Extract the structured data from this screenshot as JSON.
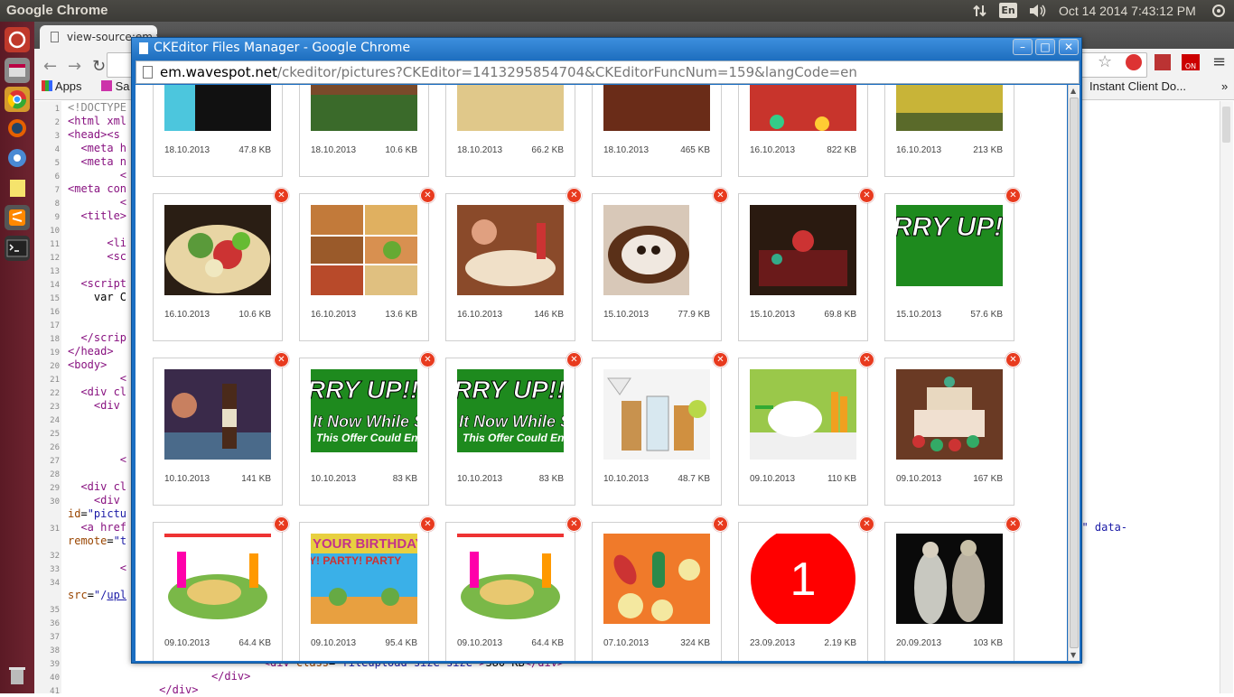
{
  "topbar": {
    "app_title": "Google Chrome",
    "language": "En",
    "clock": "Oct 14 2014  7:43:12 PM"
  },
  "background_chrome": {
    "tab_title": "view-source:em.wavesp",
    "bookmarks": [
      "Apps",
      "Sa"
    ],
    "right_bookmark": "Instant Client Do...",
    "source_lines": [
      {
        "n": "1",
        "html": "<span class='cmt'>&lt;!DOCTYPE</span>"
      },
      {
        "n": "2",
        "html": "<span class='tag'>&lt;html xml</span>"
      },
      {
        "n": "3",
        "html": "<span class='tag'>&lt;head&gt;&lt;s</span>"
      },
      {
        "n": "4",
        "html": "  <span class='tag'>&lt;meta h</span>"
      },
      {
        "n": "5",
        "html": "  <span class='tag'>&lt;meta n</span>"
      },
      {
        "n": "6",
        "html": "        <span class='tag'>&lt;</span>"
      },
      {
        "n": "7",
        "html": "<span class='tag'>&lt;meta con</span>"
      },
      {
        "n": "8",
        "html": "        <span class='tag'>&lt;</span>"
      },
      {
        "n": "9",
        "html": "  <span class='tag'>&lt;title&gt;</span>"
      },
      {
        "n": "10",
        "html": ""
      },
      {
        "n": "11",
        "html": "      <span class='tag'>&lt;li</span>"
      },
      {
        "n": "12",
        "html": "      <span class='tag'>&lt;sc</span>"
      },
      {
        "n": "13",
        "html": ""
      },
      {
        "n": "14",
        "html": "  <span class='tag'>&lt;script</span>"
      },
      {
        "n": "15",
        "html": "    var C"
      },
      {
        "n": "16",
        "html": ""
      },
      {
        "n": "17",
        "html": ""
      },
      {
        "n": "18",
        "html": "  <span class='tag'>&lt;/scrip</span>"
      },
      {
        "n": "19",
        "html": "<span class='tag'>&lt;/head&gt;</span>"
      },
      {
        "n": "20",
        "html": "<span class='tag'>&lt;body&gt;</span>"
      },
      {
        "n": "21",
        "html": "        <span class='tag'>&lt;</span>"
      },
      {
        "n": "22",
        "html": "  <span class='tag'>&lt;div cl</span>"
      },
      {
        "n": "23",
        "html": "    <span class='tag'>&lt;div</span>"
      },
      {
        "n": "24",
        "html": ""
      },
      {
        "n": "25",
        "html": ""
      },
      {
        "n": "26",
        "html": ""
      },
      {
        "n": "27",
        "html": "        <span class='tag'>&lt;</span>"
      },
      {
        "n": "28",
        "html": ""
      },
      {
        "n": "29",
        "html": "  <span class='tag'>&lt;div cl</span>"
      },
      {
        "n": "30",
        "html": "    <span class='tag'>&lt;div</span>"
      },
      {
        "n": "",
        "html": "<span class='attr'>id</span>=<span class='val'>\"pictu</span>"
      },
      {
        "n": "31",
        "html": "  <span class='tag'>&lt;a href</span>"
      },
      {
        "n": "",
        "html": "<span class='attr'>remote</span>=<span class='val'>\"t</span>"
      },
      {
        "n": "32",
        "html": ""
      },
      {
        "n": "33",
        "html": "        <span class='tag'>&lt;</span>"
      },
      {
        "n": "34",
        "html": ""
      },
      {
        "n": "",
        "html": "<span class='attr'>src</span>=<span class='val'>\"/<u>upl</u></span>"
      },
      {
        "n": "35",
        "html": ""
      },
      {
        "n": "36",
        "html": ""
      },
      {
        "n": "37",
        "html": ""
      },
      {
        "n": "38",
        "html": ""
      },
      {
        "n": "39",
        "html": "                              <span class='tag'>&lt;div</span> <span class='attr'>class</span>=<span class='val'>\"fileupload-size size\"</span><span class='tag'>&gt;</span>380 KB<span class='tag'>&lt;/div&gt;</span>"
      },
      {
        "n": "40",
        "html": "                      <span class='tag'>&lt;/div&gt;</span>"
      },
      {
        "n": "41",
        "html": "              <span class='tag'>&lt;/div&gt;</span>"
      }
    ],
    "line31_tail": "ce\" data-"
  },
  "popup": {
    "title": "CKEditor Files Manager - Google Chrome",
    "url_host": "em.wavespot.net",
    "url_path": "/ckeditor/pictures?CKEditor=1413295854704&CKEditorFuncNum=159&langCode=en",
    "delete_glyph": "✕",
    "rows": [
      [
        {
          "date": "18.10.2013",
          "size": "47.8 KB",
          "thumb": "partial-cyan-black"
        },
        {
          "date": "18.10.2013",
          "size": "10.6 KB",
          "thumb": "partial-food"
        },
        {
          "date": "18.10.2013",
          "size": "66.2 KB",
          "thumb": "partial-beige"
        },
        {
          "date": "18.10.2013",
          "size": "465 KB",
          "thumb": "partial-coffee"
        },
        {
          "date": "16.10.2013",
          "size": "822 KB",
          "thumb": "partial-party"
        },
        {
          "date": "16.10.2013",
          "size": "213 KB",
          "thumb": "partial-yellow"
        }
      ],
      [
        {
          "date": "16.10.2013",
          "size": "10.6 KB",
          "thumb": "tacos"
        },
        {
          "date": "16.10.2013",
          "size": "13.6 KB",
          "thumb": "pizza-collage"
        },
        {
          "date": "16.10.2013",
          "size": "146 KB",
          "thumb": "dining"
        },
        {
          "date": "15.10.2013",
          "size": "77.9 KB",
          "thumb": "coffee-art"
        },
        {
          "date": "15.10.2013",
          "size": "69.8 KB",
          "thumb": "table-setting"
        },
        {
          "date": "15.10.2013",
          "size": "57.6 KB",
          "thumb": "hurry-banner-small"
        }
      ],
      [
        {
          "date": "10.10.2013",
          "size": "141 KB",
          "thumb": "bar"
        },
        {
          "date": "10.10.2013",
          "size": "83 KB",
          "thumb": "hurry-banner"
        },
        {
          "date": "10.10.2013",
          "size": "83 KB",
          "thumb": "hurry-banner"
        },
        {
          "date": "10.10.2013",
          "size": "48.7 KB",
          "thumb": "cocktails"
        },
        {
          "date": "09.10.2013",
          "size": "110 KB",
          "thumb": "picnic"
        },
        {
          "date": "09.10.2013",
          "size": "167 KB",
          "thumb": "cake"
        }
      ],
      [
        {
          "date": "09.10.2013",
          "size": "64.4 KB",
          "thumb": "fiesta-table"
        },
        {
          "date": "09.10.2013",
          "size": "95.4 KB",
          "thumb": "birthday-banner"
        },
        {
          "date": "09.10.2013",
          "size": "64.4 KB",
          "thumb": "fiesta-table"
        },
        {
          "date": "07.10.2013",
          "size": "324 KB",
          "thumb": "candy-cactus"
        },
        {
          "date": "23.09.2013",
          "size": "2.19 KB",
          "thumb": "red-circle-1"
        },
        {
          "date": "20.09.2013",
          "size": "103 KB",
          "thumb": "statues"
        }
      ]
    ],
    "banner_text": {
      "hurry": "RRY UP!!",
      "now": "It Now While St",
      "offer": "This Offer Could En",
      "birthday": "YOUR BIRTHDAY",
      "party": "Y! PARTY! PARTY",
      "one": "1"
    }
  }
}
